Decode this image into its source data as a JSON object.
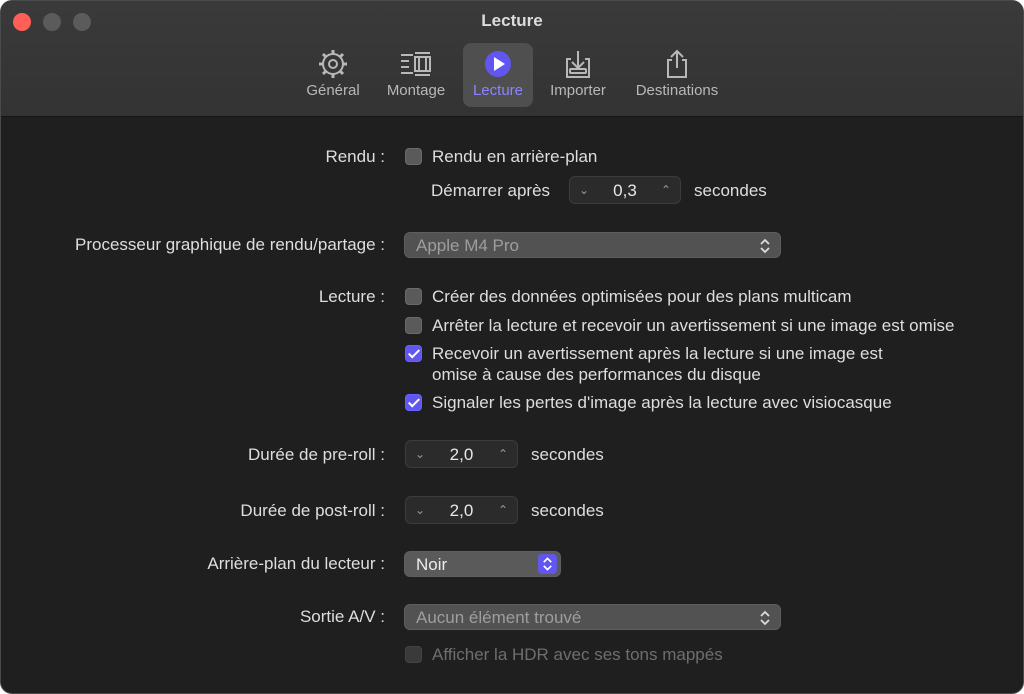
{
  "window": {
    "title": "Lecture"
  },
  "tabs": [
    {
      "label": "Général",
      "icon": "gear-icon"
    },
    {
      "label": "Montage",
      "icon": "timeline-icon"
    },
    {
      "label": "Lecture",
      "icon": "play-icon",
      "active": true
    },
    {
      "label": "Importer",
      "icon": "import-icon"
    },
    {
      "label": "Destinations",
      "icon": "share-icon"
    }
  ],
  "rendu": {
    "label": "Rendu :",
    "background_render": {
      "label": "Rendu en arrière-plan",
      "checked": false
    },
    "start_after": {
      "label": "Démarrer après",
      "value": "0,3",
      "unit": "secondes"
    }
  },
  "gpu": {
    "label": "Processeur graphique de rendu/partage :",
    "value": "Apple M4 Pro"
  },
  "lecture": {
    "label": "Lecture :",
    "options": [
      {
        "text": "Créer des données optimisées pour des plans multicam",
        "checked": false
      },
      {
        "text": "Arrêter la lecture et recevoir un avertissement si une image est omise",
        "checked": false
      },
      {
        "text_line1": "Recevoir un avertissement après la lecture si une image est",
        "text_line2": "omise à cause des performances du disque",
        "checked": true
      },
      {
        "text": "Signaler les pertes d'image après la lecture avec visiocasque",
        "checked": true
      }
    ]
  },
  "preroll": {
    "label": "Durée de pre-roll :",
    "value": "2,0",
    "unit": "secondes"
  },
  "postroll": {
    "label": "Durée de post-roll :",
    "value": "2,0",
    "unit": "secondes"
  },
  "player_bg": {
    "label": "Arrière-plan du lecteur :",
    "value": "Noir"
  },
  "av_output": {
    "label": "Sortie A/V :",
    "value": "Aucun élément trouvé"
  },
  "hdr": {
    "label": "Afficher la HDR avec ses tons mappés",
    "checked": false,
    "disabled": true
  },
  "colors": {
    "accent": "#6157f0",
    "active_tab_text": "#8b83ff",
    "close": "#ff5f57"
  }
}
